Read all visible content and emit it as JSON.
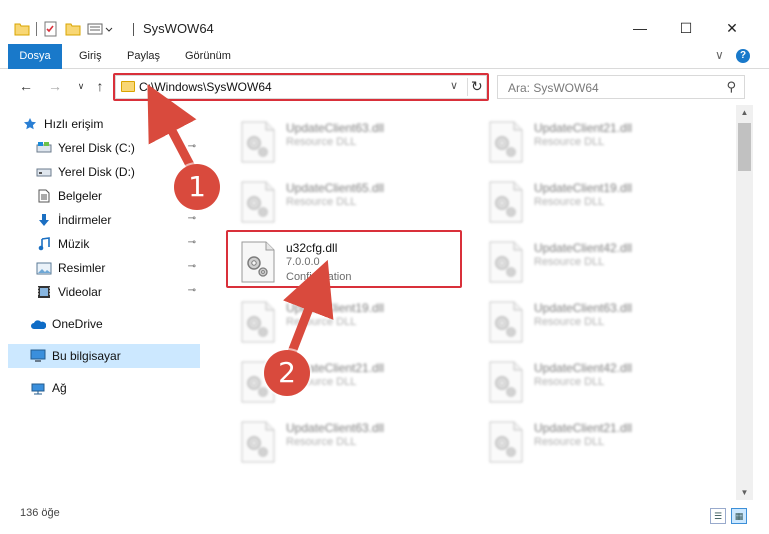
{
  "window": {
    "title": "SysWOW64",
    "minimize": "—",
    "maximize": "☐",
    "close": "✕"
  },
  "ribbon": {
    "tabs": [
      "Dosya",
      "Giriş",
      "Paylaş",
      "Görünüm"
    ],
    "collapse_chevron": "∨",
    "help": "?"
  },
  "nav": {
    "back": "←",
    "forward": "→",
    "recent": "∨",
    "up": "↑"
  },
  "address": {
    "path": "C:\\Windows\\SysWOW64",
    "dropdown": "∨",
    "refresh": "↻"
  },
  "search": {
    "placeholder": "Ara: SysWOW64",
    "icon": "⚲"
  },
  "sidebar": {
    "items": [
      {
        "label": "Hızlı erişim",
        "icon": "star-icon",
        "pinned": false
      },
      {
        "label": "Yerel Disk (C:)",
        "icon": "drive-icon",
        "pinned": true
      },
      {
        "label": "Yerel Disk (D:)",
        "icon": "drive-icon",
        "pinned": false
      },
      {
        "label": "Belgeler",
        "icon": "document-icon",
        "pinned": true
      },
      {
        "label": "İndirmeler",
        "icon": "download-icon",
        "pinned": true
      },
      {
        "label": "Müzik",
        "icon": "music-icon",
        "pinned": true
      },
      {
        "label": "Resimler",
        "icon": "picture-icon",
        "pinned": true
      },
      {
        "label": "Videolar",
        "icon": "video-icon",
        "pinned": true
      },
      {
        "label": "OneDrive",
        "icon": "cloud-icon",
        "pinned": false
      },
      {
        "label": "Bu bilgisayar",
        "icon": "computer-icon",
        "pinned": false,
        "selected": true
      },
      {
        "label": "Ağ",
        "icon": "network-icon",
        "pinned": false
      }
    ],
    "pin_glyph": "⊸"
  },
  "files": [
    {
      "name": "UpdateClient63.dll",
      "line1": "Resource DLL",
      "line2": "",
      "blurred": true
    },
    {
      "name": "UpdateClient21.dll",
      "line1": "Resource DLL",
      "line2": "",
      "blurred": true
    },
    {
      "name": "UpdateClient65.dll",
      "line1": "Resource DLL",
      "line2": "",
      "blurred": true
    },
    {
      "name": "UpdateClient19.dll",
      "line1": "Resource DLL",
      "line2": "",
      "blurred": true
    },
    {
      "name": "u32cfg.dll",
      "line1": "7.0.0.0",
      "line2": "Configuration",
      "blurred": false
    },
    {
      "name": "UpdateClient42.dll",
      "line1": "Resource DLL",
      "line2": "",
      "blurred": true
    },
    {
      "name": "UpdateClient19.dll",
      "line1": "Resource DLL",
      "line2": "",
      "blurred": true
    },
    {
      "name": "UpdateClient63.dll",
      "line1": "Resource DLL",
      "line2": "",
      "blurred": true
    },
    {
      "name": "UpdateClient21.dll",
      "line1": "Resource DLL",
      "line2": "",
      "blurred": true
    },
    {
      "name": "UpdateClient42.dll",
      "line1": "Resource DLL",
      "line2": "",
      "blurred": true
    },
    {
      "name": "UpdateClient63.dll",
      "line1": "Resource DLL",
      "line2": "",
      "blurred": true
    },
    {
      "name": "UpdateClient21.dll",
      "line1": "Resource DLL",
      "line2": "",
      "blurred": true
    }
  ],
  "scrollbar": {
    "up": "▲",
    "down": "▼"
  },
  "status": {
    "count": "136 öğe",
    "details_view": "☰",
    "tiles_view": "▦"
  },
  "annotations": {
    "step1": "1",
    "step2": "2",
    "color": "#d9303a"
  }
}
